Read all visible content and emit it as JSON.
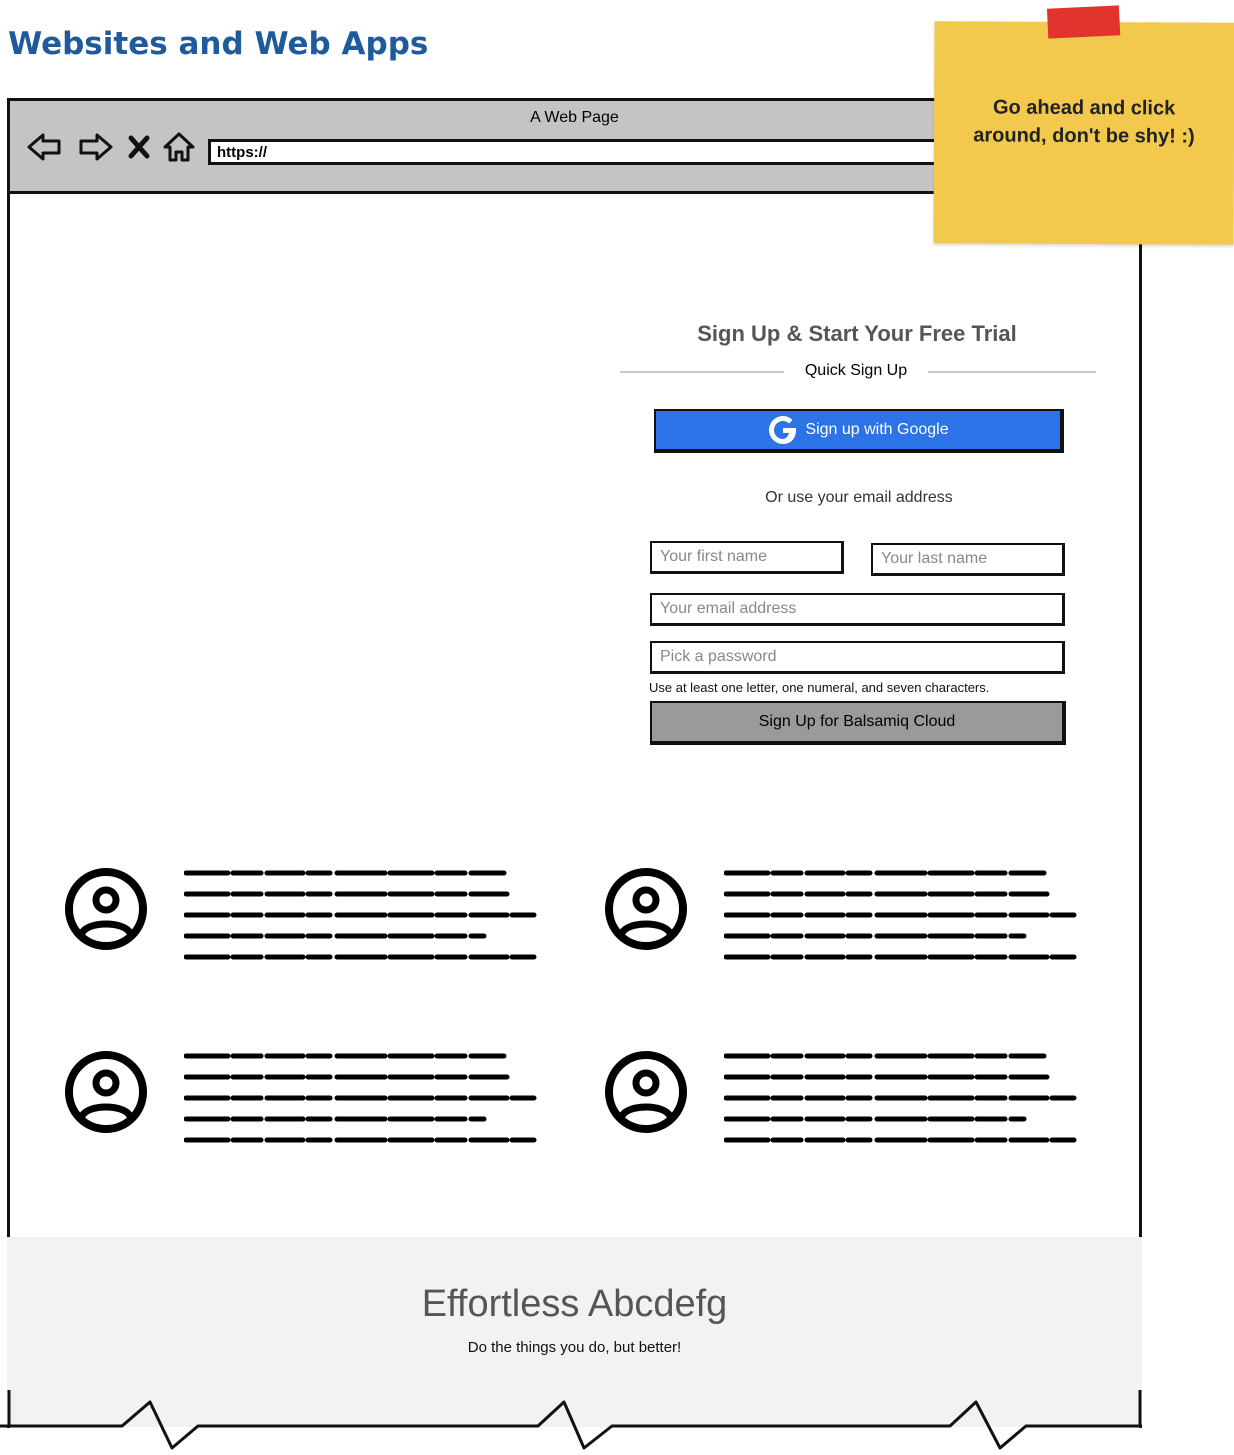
{
  "page": {
    "heading": "Websites and Web Apps"
  },
  "browser": {
    "title": "A Web Page",
    "url": "https://",
    "nav_icons": [
      "back-arrow-icon",
      "forward-arrow-icon",
      "stop-icon",
      "home-icon"
    ]
  },
  "sticky_note": {
    "text": "Go ahead and click around, don't be shy! :)",
    "color": "#f2c94c",
    "tape_color": "#e2342f"
  },
  "signup": {
    "title": "Sign Up & Start Your Free Trial",
    "quick_label": "Quick Sign Up",
    "google_button": "Sign up with Google",
    "or_text": "Or use your email address",
    "first_name_placeholder": "Your first name",
    "last_name_placeholder": "Your last name",
    "email_placeholder": "Your email address",
    "password_placeholder": "Pick a password",
    "password_hint": "Use at least one letter, one numeral, and seven characters.",
    "submit_button": "Sign Up for Balsamiq Cloud",
    "google_color": "#2b73e6"
  },
  "testimonials": [
    {
      "icon": "user-avatar-icon"
    },
    {
      "icon": "user-avatar-icon"
    },
    {
      "icon": "user-avatar-icon"
    },
    {
      "icon": "user-avatar-icon"
    }
  ],
  "banner": {
    "title": "Effortless Abcdefg",
    "subtitle": "Do the things you do, but better!"
  }
}
